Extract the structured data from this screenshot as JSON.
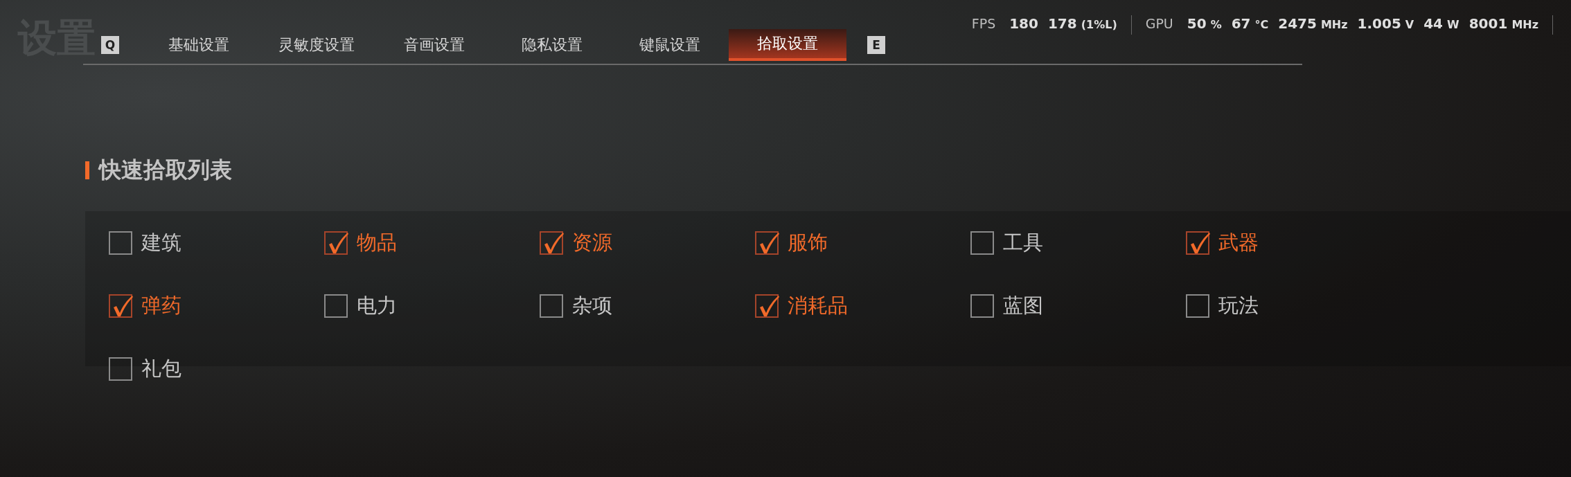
{
  "title": "设置",
  "tab_keys": {
    "prev": "Q",
    "next": "E"
  },
  "tabs": [
    {
      "label": "基础设置",
      "selected": false
    },
    {
      "label": "灵敏度设置",
      "selected": false
    },
    {
      "label": "音画设置",
      "selected": false
    },
    {
      "label": "隐私设置",
      "selected": false
    },
    {
      "label": "键鼠设置",
      "selected": false
    },
    {
      "label": "拾取设置",
      "selected": true
    }
  ],
  "perf_overlay": {
    "fps": {
      "label": "FPS",
      "values": [
        "180",
        "178"
      ],
      "note": "(1%L)"
    },
    "gpu": {
      "label": "GPU",
      "readings": [
        {
          "value": "50",
          "unit": "%"
        },
        {
          "value": "67",
          "unit": "°C"
        },
        {
          "value": "2475",
          "unit": "MHz"
        },
        {
          "value": "1.005",
          "unit": "V"
        },
        {
          "value": "44",
          "unit": "W"
        },
        {
          "value": "8001",
          "unit": "MHz"
        }
      ]
    }
  },
  "section": {
    "heading": "快速拾取列表",
    "options": [
      {
        "label": "建筑",
        "checked": false
      },
      {
        "label": "物品",
        "checked": true
      },
      {
        "label": "资源",
        "checked": true
      },
      {
        "label": "服饰",
        "checked": true
      },
      {
        "label": "工具",
        "checked": false
      },
      {
        "label": "武器",
        "checked": true
      },
      {
        "label": "弹药",
        "checked": true
      },
      {
        "label": "电力",
        "checked": false
      },
      {
        "label": "杂项",
        "checked": false
      },
      {
        "label": "消耗品",
        "checked": true
      },
      {
        "label": "蓝图",
        "checked": false
      },
      {
        "label": "玩法",
        "checked": false
      },
      {
        "label": "礼包",
        "checked": false
      }
    ]
  }
}
